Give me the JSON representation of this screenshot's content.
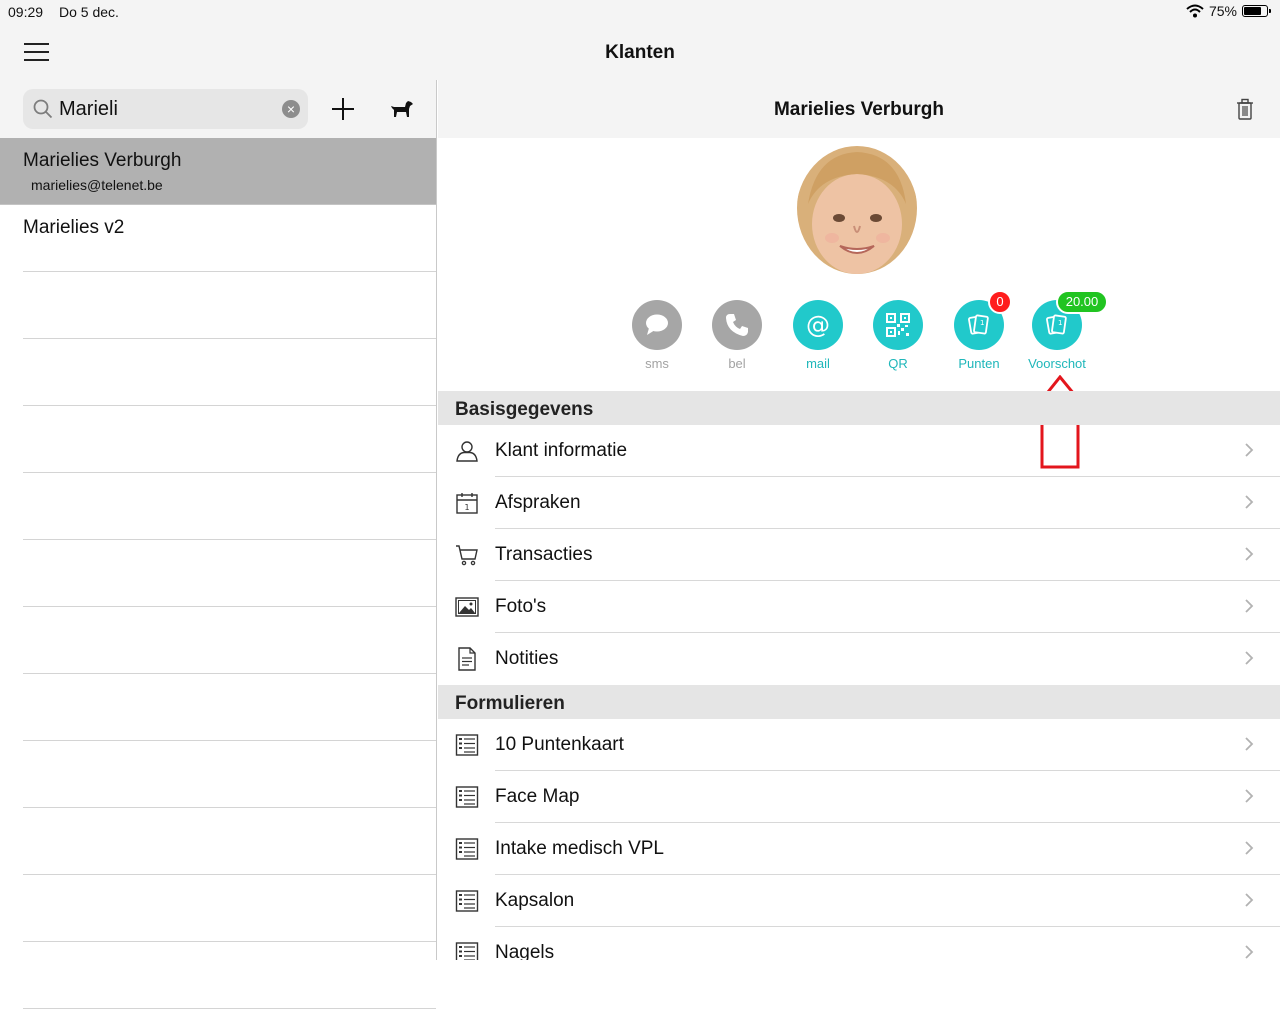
{
  "status_bar": {
    "time": "09:29",
    "date": "Do 5 dec.",
    "battery": "75%",
    "battery_level": 0.75
  },
  "nav": {
    "title": "Klanten"
  },
  "search": {
    "value": "Marieli"
  },
  "clients": [
    {
      "name": "Marielies Verburgh",
      "email": "marielies@telenet.be",
      "selected": true
    },
    {
      "name": "Marielies v2",
      "email": "",
      "selected": false
    }
  ],
  "detail": {
    "title": "Marielies Verburgh",
    "actions": [
      {
        "label": "sms",
        "icon": "chat-bubble-icon",
        "color": "#a6a6a6"
      },
      {
        "label": "bel",
        "icon": "phone-icon",
        "color": "#a6a6a6"
      },
      {
        "label": "mail",
        "icon": "at-sign-icon",
        "color": "#21c9cb"
      },
      {
        "label": "QR",
        "icon": "qr-code-icon",
        "color": "#21c9cb"
      },
      {
        "label": "Punten",
        "icon": "cards-icon",
        "color": "#21c9cb",
        "badge": "0"
      },
      {
        "label": "Voorschot",
        "icon": "cards-icon",
        "color": "#21c9cb",
        "badge": "20.00"
      }
    ],
    "sections": [
      {
        "title": "Basisgegevens",
        "items": [
          {
            "label": "Klant informatie",
            "icon": "person-icon"
          },
          {
            "label": "Afspraken",
            "icon": "calendar-icon"
          },
          {
            "label": "Transacties",
            "icon": "cart-icon"
          },
          {
            "label": "Foto's",
            "icon": "photo-icon"
          },
          {
            "label": "Notities",
            "icon": "note-icon"
          }
        ]
      },
      {
        "title": "Formulieren",
        "items": [
          {
            "label": "10 Puntenkaart",
            "icon": "form-icon"
          },
          {
            "label": "Face Map",
            "icon": "form-icon"
          },
          {
            "label": "Intake medisch VPL",
            "icon": "form-icon"
          },
          {
            "label": "Kapsalon",
            "icon": "form-icon"
          },
          {
            "label": "Nagels",
            "icon": "form-icon"
          }
        ]
      }
    ]
  },
  "colors": {
    "accent": "#21c9cb",
    "badge_red": "#ff1d1d",
    "badge_green": "#21c421",
    "annotation_arrow": "#e3161d"
  }
}
